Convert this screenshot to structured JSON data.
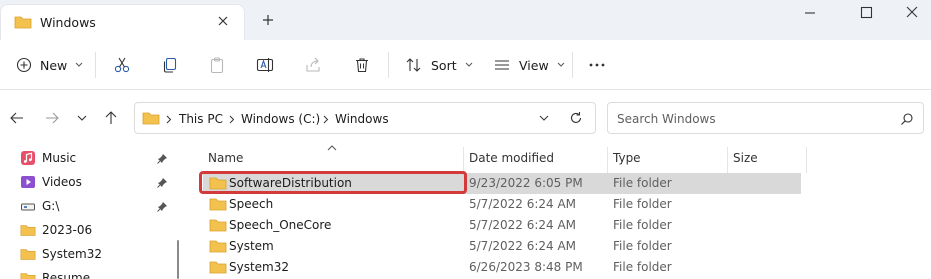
{
  "window": {
    "tab_title": "Windows",
    "new_tab_label": "+"
  },
  "toolbar": {
    "new_label": "New",
    "sort_label": "Sort",
    "view_label": "View"
  },
  "address": {
    "crumbs": [
      "This PC",
      "Windows (C:)",
      "Windows"
    ]
  },
  "search": {
    "placeholder": "Search Windows"
  },
  "nav": {
    "items": [
      {
        "label": "Music",
        "icon": "music-icon",
        "pinned": true
      },
      {
        "label": "Videos",
        "icon": "videos-icon",
        "pinned": true
      },
      {
        "label": "G:\\",
        "icon": "drive-icon",
        "pinned": true
      },
      {
        "label": "2023-06",
        "icon": "folder-icon",
        "pinned": false
      },
      {
        "label": "System32",
        "icon": "folder-icon",
        "pinned": false
      },
      {
        "label": "Resume",
        "icon": "folder-icon",
        "pinned": false
      }
    ]
  },
  "columns": {
    "name": "Name",
    "date": "Date modified",
    "type": "Type",
    "size": "Size"
  },
  "files": [
    {
      "name": "SoftwareDistribution",
      "date": "9/23/2022 6:05 PM",
      "type": "File folder",
      "selected": true
    },
    {
      "name": "Speech",
      "date": "5/7/2022 6:24 AM",
      "type": "File folder",
      "selected": false
    },
    {
      "name": "Speech_OneCore",
      "date": "5/7/2022 6:24 AM",
      "type": "File folder",
      "selected": false
    },
    {
      "name": "System",
      "date": "5/7/2022 6:24 AM",
      "type": "File folder",
      "selected": false
    },
    {
      "name": "System32",
      "date": "6/26/2023 8:48 PM",
      "type": "File folder",
      "selected": false
    }
  ],
  "colors": {
    "folder": "#f2c14e",
    "highlight": "#d33a3a",
    "selection": "#d9d9d9"
  }
}
